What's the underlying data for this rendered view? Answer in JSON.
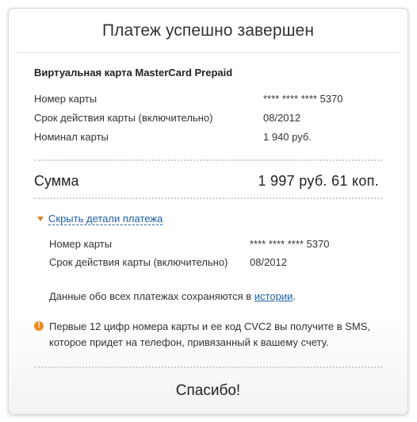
{
  "title": "Платеж успешно завершен",
  "card_section": {
    "title": "Виртуальная карта MasterCard Prepaid",
    "rows": [
      {
        "label": "Номер карты",
        "value": "**** **** **** 5370"
      },
      {
        "label": "Срок действия карты (включительно)",
        "value": "08/2012"
      },
      {
        "label": "Номинал карты",
        "value": "1 940 руб."
      }
    ]
  },
  "total": {
    "label": "Сумма",
    "value": "1 997 руб. 61 коп."
  },
  "details": {
    "toggle_label": "Скрыть детали платежа",
    "rows": [
      {
        "label": "Номер карты",
        "value": "**** **** **** 5370"
      },
      {
        "label": "Срок действия карты (включительно)",
        "value": "08/2012"
      }
    ]
  },
  "history": {
    "text": "Данные обо всех платежах сохраняются в ",
    "link": "истории",
    "suffix": "."
  },
  "notice": {
    "icon": "info-icon",
    "icon_glyph": "!",
    "text": "Первые 12 цифр номера карты и ее код CVC2 вы получите в SMS, которое придет на телефон, привязанный к вашему счету."
  },
  "thanks": "Спасибо!",
  "colors": {
    "link": "#1f5fa8",
    "accent": "#ee8a22",
    "text": "#333333"
  }
}
